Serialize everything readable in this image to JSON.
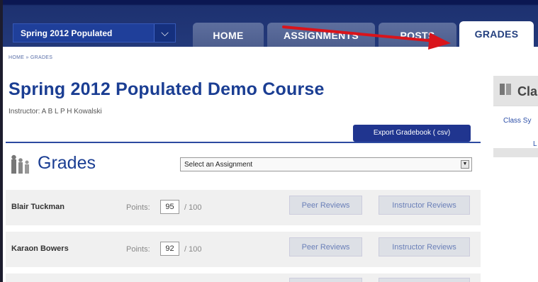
{
  "nav": {
    "course_selector": "Spring 2012 Populated",
    "tabs": [
      {
        "label": "HOME",
        "active": false
      },
      {
        "label": "ASSIGNMENTS",
        "active": false
      },
      {
        "label": "POSTS",
        "active": false
      },
      {
        "label": "GRADES",
        "active": true
      }
    ]
  },
  "breadcrumb": "HOME » GRADES",
  "course": {
    "title": "Spring 2012 Populated Demo Course",
    "instructor": "Instructor: A B L P H Kowalski"
  },
  "export_button": "Export Gradebook ( csv)",
  "grades": {
    "heading": "Grades",
    "assignment_select": "Select an Assignment",
    "points_label": "Points:",
    "points_max": "/ 100",
    "peer_reviews_label": "Peer Reviews",
    "instructor_reviews_label": "Instructor Reviews",
    "students": [
      {
        "name": "Blair Tuckman",
        "points": "95"
      },
      {
        "name": "Karaon Bowers",
        "points": "92"
      }
    ]
  },
  "side_panel": {
    "title": "Cla",
    "link": "Class Sy",
    "link2": "L"
  },
  "colors": {
    "nav_bar": "#23397a",
    "title_blue": "#1b3e93",
    "export_button": "#20358f",
    "annotation_arrow": "#d9141b"
  },
  "icons": [
    "chevron-down-icon",
    "people-icon",
    "book-icon",
    "red-annotation-arrow"
  ]
}
